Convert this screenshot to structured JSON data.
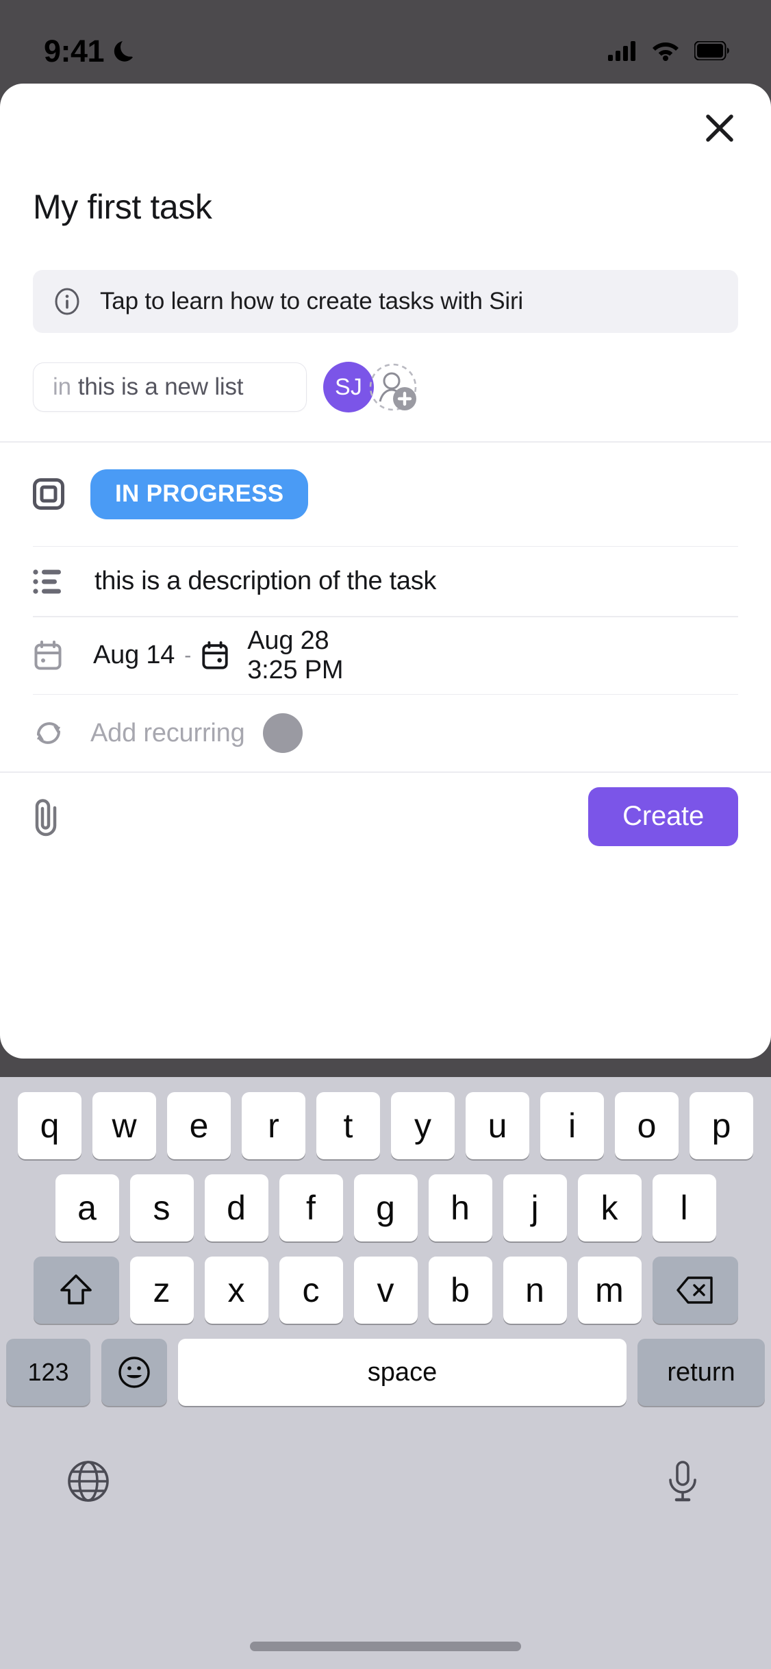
{
  "status_bar": {
    "time": "9:41",
    "dnd_icon": "moon-icon",
    "signal_icon": "cellular-signal-icon",
    "wifi_icon": "wifi-icon",
    "battery_icon": "battery-icon"
  },
  "sheet": {
    "close_icon": "close-icon",
    "title": "My first task",
    "siri_banner": {
      "icon": "info-circle-icon",
      "text": "Tap to learn how to create tasks with Siri"
    },
    "list_field": {
      "prefix": "in",
      "value": "this is a new list",
      "placeholder": "this is a new list"
    },
    "assignees": {
      "avatar_initials": "SJ",
      "avatar_color": "#7b55e8",
      "add_icon": "add-person-icon"
    },
    "rows": {
      "status": {
        "icon": "status-square-icon",
        "label": "IN PROGRESS",
        "color": "#4a9bf5"
      },
      "description": {
        "icon": "bullet-list-icon",
        "text": "this is a description of the task"
      },
      "dates": {
        "start_icon": "calendar-icon",
        "start": "Aug 14",
        "separator": "-",
        "end_icon": "calendar-filled-icon",
        "end_date": "Aug 28",
        "end_time": "3:25 PM"
      },
      "recurring": {
        "icon": "recurring-icon",
        "label": "Add recurring",
        "dot_color": "#9a9aa2"
      }
    },
    "footer": {
      "attach_icon": "paperclip-icon",
      "create_label": "Create",
      "create_color": "#7b55e8"
    }
  },
  "keyboard": {
    "row1": [
      "q",
      "w",
      "e",
      "r",
      "t",
      "y",
      "u",
      "i",
      "o",
      "p"
    ],
    "row2": [
      "a",
      "s",
      "d",
      "f",
      "g",
      "h",
      "j",
      "k",
      "l"
    ],
    "row3": [
      "z",
      "x",
      "c",
      "v",
      "b",
      "n",
      "m"
    ],
    "shift_icon": "shift-icon",
    "delete_icon": "delete-icon",
    "numbers_label": "123",
    "emoji_icon": "emoji-icon",
    "space_label": "space",
    "return_label": "return",
    "globe_icon": "globe-icon",
    "mic_icon": "microphone-icon"
  }
}
